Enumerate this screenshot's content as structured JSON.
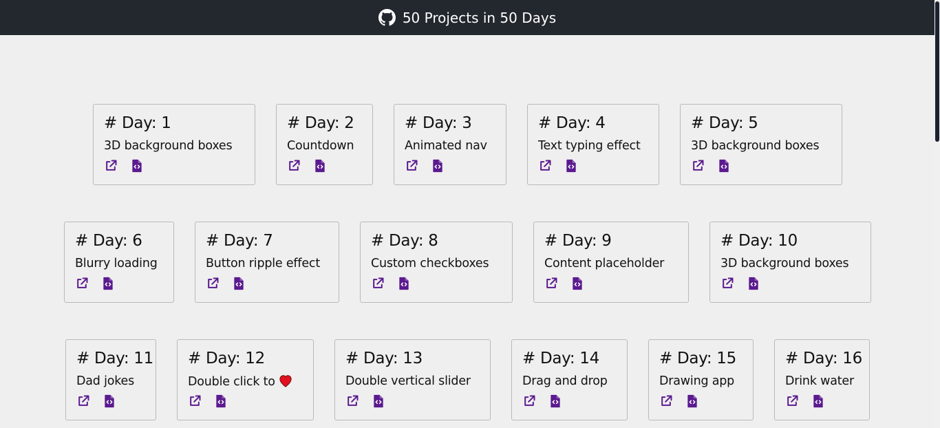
{
  "header": {
    "title": "50 Projects in 50 Days",
    "icon": "github-icon",
    "background": "#23272e"
  },
  "accent_color": "#5b1a8f",
  "cards": [
    {
      "title": "# Day: 1",
      "name": "3D background boxes"
    },
    {
      "title": "# Day: 2",
      "name": "Countdown"
    },
    {
      "title": "# Day: 3",
      "name": "Animated nav"
    },
    {
      "title": "# Day: 4",
      "name": "Text typing effect"
    },
    {
      "title": "# Day: 5",
      "name": "3D background boxes"
    },
    {
      "title": "# Day: 6",
      "name": "Blurry loading"
    },
    {
      "title": "# Day: 7",
      "name": "Button ripple effect"
    },
    {
      "title": "# Day: 8",
      "name": "Custom checkboxes"
    },
    {
      "title": "# Day: 9",
      "name": "Content placeholder"
    },
    {
      "title": "# Day: 10",
      "name": "3D background boxes"
    },
    {
      "title": "# Day: 11",
      "name": "Dad jokes"
    },
    {
      "title": "# Day: 12",
      "name": "Double click to",
      "emoji": "heart-icon"
    },
    {
      "title": "# Day: 13",
      "name": "Double vertical slider"
    },
    {
      "title": "# Day: 14",
      "name": "Drag and drop"
    },
    {
      "title": "# Day: 15",
      "name": "Drawing app"
    },
    {
      "title": "# Day: 16",
      "name": "Drink water"
    }
  ]
}
